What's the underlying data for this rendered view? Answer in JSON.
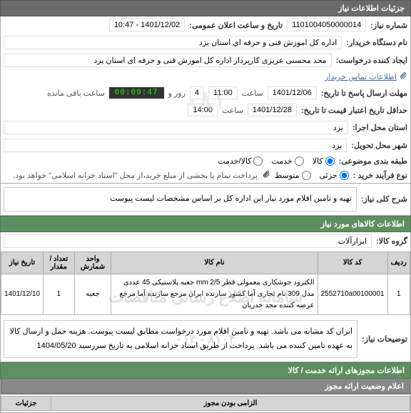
{
  "header": {
    "title": "جزئیات اطلاعات نیاز"
  },
  "form": {
    "niaz_no_label": "شماره نیاز:",
    "niaz_no": "1101004050000014",
    "announce_label": "تاریخ و ساعت اعلان عمومی:",
    "announce_value": "1401/12/02 - 10:47",
    "buyer_org_label": "نام دستگاه خریدار:",
    "buyer_org": "اداره کل اموزش فنی و حرفه ای استان یزد",
    "creator_label": "ایجاد کننده درخواست:",
    "creator": "محد محسنی عزیزی کارپرداز اداره کل اموزش فنی و حرفه ای استان یزد",
    "contact_link": "اطلاعات تماس خریدار",
    "deadline_label": "مهلت ارسال پاسخ تا تاریخ:",
    "deadline_date": "1401/12/06",
    "saat": "ساعت",
    "deadline_time": "11:00",
    "day_count": "4",
    "rooz_va": "روز و",
    "countdown": "00:09:47",
    "remain": "ساعت باقی مانده",
    "min_credit_label": "حداقل تاریخ اعتبار قیمت تا تاریخ:",
    "min_credit_date": "1401/12/28",
    "min_credit_time": "14:00",
    "exec_loc_label": "استان محل اجرا:",
    "exec_loc": "یزد",
    "deliv_city_label": "شهر محل تحویل:",
    "deliv_city": "یزد",
    "budget_class_label": "طبقه بندی موضوعی:",
    "budget_radios": {
      "goods": "کالا",
      "service": "خدمت",
      "goods_service": "کالا/خدمت"
    },
    "budget_selected": "goods",
    "proc_type_label": "نوع فرآیند خرید :",
    "proc_radios": {
      "part": "جزئی",
      "mid": "متوسط"
    },
    "proc_selected": "part",
    "proc_note": "پرداخت تمام یا بخشی از مبلغ خرید،از محل \"اسناد خزانه اسلامی\" خواهد بود."
  },
  "need": {
    "title_label": "شرح کلی نیاز:",
    "title_value": "تهیه و تامین اقلام مورد نیاز این اداره کل بر اساس مشخصات لیست پیوست",
    "section_title": "اطلاعات کالاهای مورد نیاز",
    "group_label": "گروه کالا:",
    "group_value": "ابزارآلات",
    "table": {
      "headers": {
        "row": "ردیف",
        "code": "کد کالا",
        "name": "نام کالا",
        "unit": "واحد شمارش",
        "qty": "تعداد / مقدار",
        "date": "تاریخ نیاز"
      },
      "rows": [
        {
          "row": "1",
          "code": "2552710a00100001",
          "name": "الکترود جوشکاری معمولی قطر 2/5 mm جعبه پلاستیکی 45 عددی مدل 309 نام تجاری آما کشور سازنده ایران مرجع سازنده آما مرجع عرضه کننده مجد خدریان",
          "unit": "جعبه",
          "qty": "1",
          "date": "1401/12/10"
        }
      ]
    },
    "desc_label": "توضیحات نیاز:",
    "desc_value": "ایران کد مشابه می باشد. تهیه و تامین اقلام مورد درخواست مطابق لیست پیوست. هزینه حمل و ارسال کالا به عهده تامین کننده می باشد. پرداخت از طریق اسناد خزانه اسلامی به تاریخ سررسید 1404/05/20"
  },
  "perm": {
    "section_title": "اطلاعات مجوزهای ارائه خدمت / کالا",
    "status_title": "اعلام وضعیت ارائه مجوز",
    "col1": "الزامی بودن مجوز",
    "col2": "جزئیات"
  },
  "watermarks": {
    "bg1": "۰۸۱",
    "bg2": "سامانه اطلاع رسانی مناقصات",
    "bg3": "۸۱۰۴ - ۰۱۲"
  }
}
